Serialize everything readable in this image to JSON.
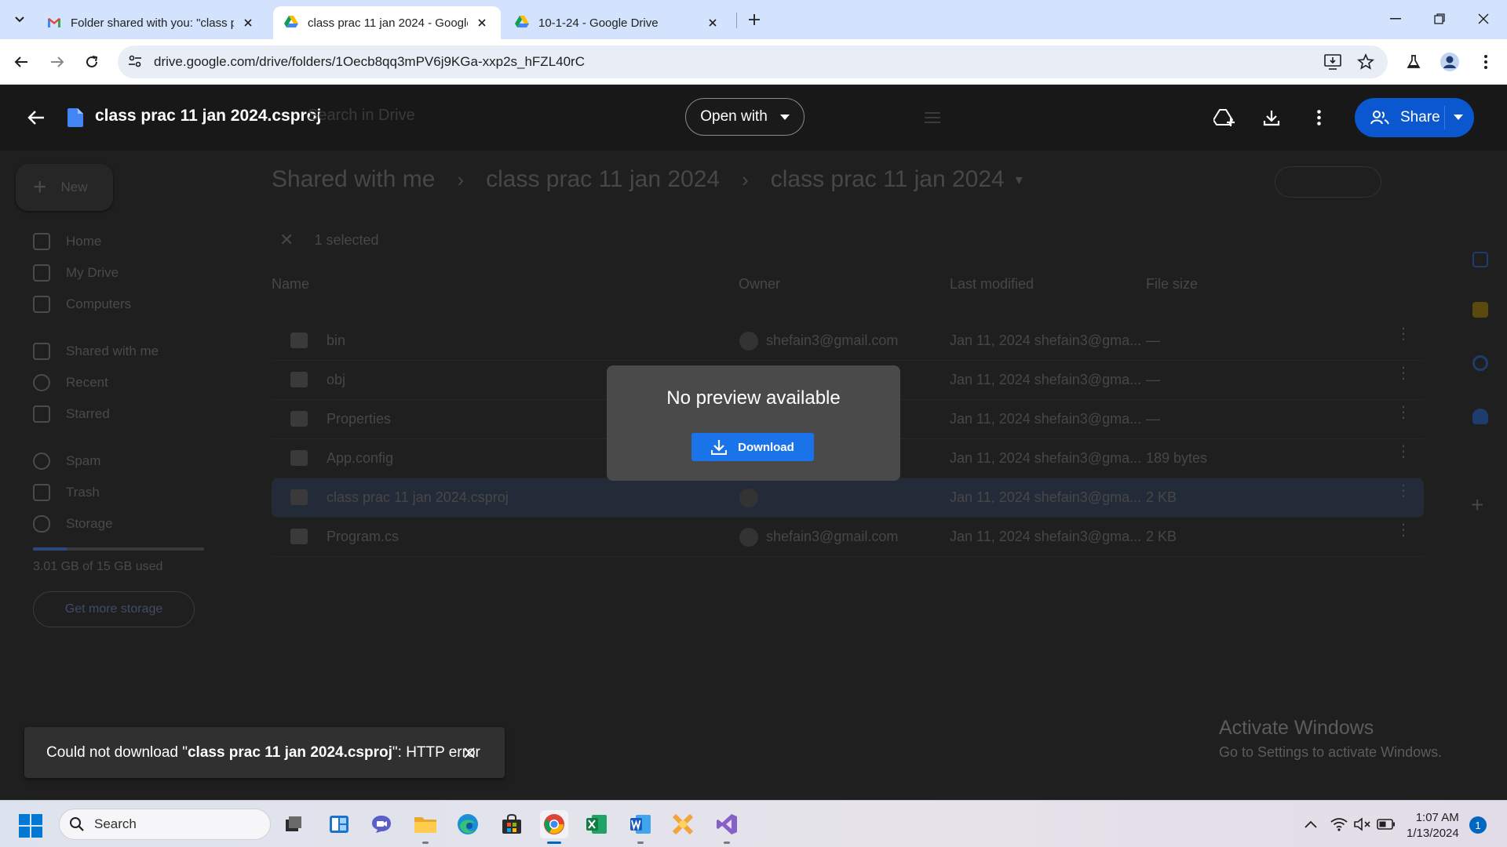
{
  "browser": {
    "tabs": [
      {
        "title": "Folder shared with you: \"class p",
        "favicon": "gmail-icon",
        "active": false
      },
      {
        "title": "class prac 11 jan 2024 - Google",
        "favicon": "google-drive-icon",
        "active": true
      },
      {
        "title": "10-1-24 - Google Drive",
        "favicon": "google-drive-icon",
        "active": false
      }
    ],
    "url": "drive.google.com/drive/folders/1Oecb8qq3mPV6j9KGa-xxp2s_hFZL40rC"
  },
  "viewer": {
    "file_title": "class prac 11 jan 2024.csproj",
    "open_with_label": "Open with",
    "share_label": "Share",
    "search_hint": "Search in Drive"
  },
  "drive": {
    "new_label": "New",
    "nav": [
      "Home",
      "My Drive",
      "Computers",
      "Shared with me",
      "Recent",
      "Starred",
      "Spam",
      "Trash",
      "Storage"
    ],
    "storage_text": "3.01 GB of 15 GB used",
    "storage_fraction": 0.2,
    "get_more_storage": "Get more storage",
    "breadcrumb": [
      "Shared with me",
      "class prac 11 jan 2024",
      "class prac 11 jan 2024"
    ],
    "selected_text": "1 selected",
    "columns": {
      "name": "Name",
      "owner": "Owner",
      "modified": "Last modified",
      "size": "File size"
    },
    "rows": [
      {
        "name": "bin",
        "owner": "shefain3@gmail.com",
        "modified": "Jan 11, 2024 shefain3@gma...",
        "size": "—",
        "selected": false
      },
      {
        "name": "obj",
        "owner": "shefain3@gmail.com",
        "modified": "Jan 11, 2024 shefain3@gma...",
        "size": "—",
        "selected": false
      },
      {
        "name": "Properties",
        "owner": "",
        "modified": "Jan 11, 2024 shefain3@gma...",
        "size": "—",
        "selected": false
      },
      {
        "name": "App.config",
        "owner": "",
        "modified": "Jan 11, 2024 shefain3@gma...",
        "size": "189 bytes",
        "selected": false
      },
      {
        "name": "class prac 11 jan 2024.csproj",
        "owner": "",
        "modified": "Jan 11, 2024 shefain3@gma...",
        "size": "2 KB",
        "selected": true
      },
      {
        "name": "Program.cs",
        "owner": "shefain3@gmail.com",
        "modified": "Jan 11, 2024 shefain3@gma...",
        "size": "2 KB",
        "selected": false
      }
    ]
  },
  "dialog": {
    "title": "No preview available",
    "download_label": "Download"
  },
  "toast": {
    "prefix": "Could not download \"",
    "filename": "class prac 11 jan 2024.csproj",
    "suffix": "\": HTTP error"
  },
  "watermark": {
    "line1": "Activate Windows",
    "line2": "Go to Settings to activate Windows."
  },
  "taskbar": {
    "search_label": "Search",
    "time": "1:07 AM",
    "date": "1/13/2024",
    "notification_count": "1"
  },
  "colors": {
    "accent": "#0b57d0",
    "download_button": "#1a73e8",
    "dialog_bg": "#4a4a4a"
  }
}
